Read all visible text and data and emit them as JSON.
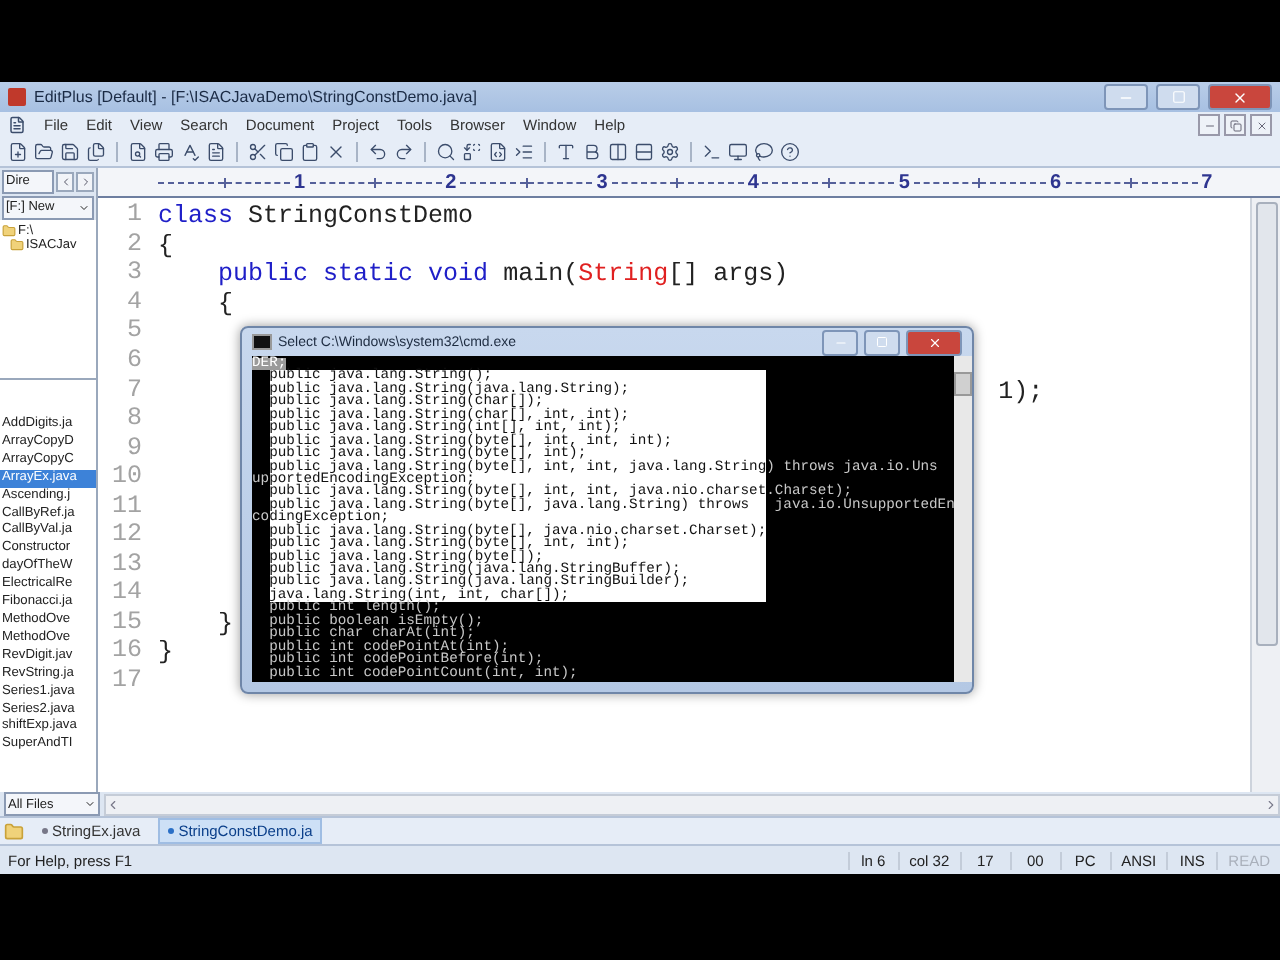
{
  "window": {
    "title": "EditPlus [Default] - [F:\\ISACJavaDemo\\StringConstDemo.java]"
  },
  "menu": [
    "File",
    "Edit",
    "View",
    "Search",
    "Document",
    "Project",
    "Tools",
    "Browser",
    "Window",
    "Help"
  ],
  "directory_panel": {
    "directory_label": "Dire",
    "drive": "[F:] New",
    "tree": [
      {
        "label": "F:\\",
        "children": [
          {
            "label": "ISACJav"
          }
        ]
      }
    ],
    "files": [
      {
        "name": "AddDigits.ja",
        "selected": false
      },
      {
        "name": "ArrayCopyD",
        "selected": false
      },
      {
        "name": "ArrayCopyC",
        "selected": false
      },
      {
        "name": "ArrayEx.java",
        "selected": true
      },
      {
        "name": "Ascending.j",
        "selected": false
      },
      {
        "name": "CallByRef.ja",
        "selected": false
      },
      {
        "name": "CallByVal.ja",
        "selected": false
      },
      {
        "name": "Constructor",
        "selected": false
      },
      {
        "name": "dayOfTheW",
        "selected": false
      },
      {
        "name": "ElectricalRe",
        "selected": false
      },
      {
        "name": "Fibonacci.ja",
        "selected": false
      },
      {
        "name": "MethodOve",
        "selected": false
      },
      {
        "name": "MethodOve",
        "selected": false
      },
      {
        "name": "RevDigit.jav",
        "selected": false
      },
      {
        "name": "RevString.ja",
        "selected": false
      },
      {
        "name": "Series1.java",
        "selected": false
      },
      {
        "name": "Series2.java",
        "selected": false
      },
      {
        "name": "shiftExp.java",
        "selected": false
      },
      {
        "name": "SuperAndTI",
        "selected": false
      }
    ],
    "filter": "All Files"
  },
  "ruler": [
    "1",
    "2",
    "3",
    "4",
    "5",
    "6",
    "7"
  ],
  "editor": {
    "lines": [
      {
        "number": "1",
        "tokens": [
          {
            "text": "class",
            "kind": "keyword"
          },
          {
            "text": " StringConstDemo",
            "kind": "plain"
          }
        ]
      },
      {
        "number": "2",
        "tokens": [
          {
            "text": "{",
            "kind": "plain"
          }
        ]
      },
      {
        "number": "3",
        "tokens": [
          {
            "text": "    public",
            "kind": "keyword"
          },
          {
            "text": " static",
            "kind": "keyword"
          },
          {
            "text": " void",
            "kind": "keyword"
          },
          {
            "text": " main(",
            "kind": "plain"
          },
          {
            "text": "String",
            "kind": "type"
          },
          {
            "text": "[] args)",
            "kind": "plain"
          }
        ]
      },
      {
        "number": "4",
        "tokens": [
          {
            "text": "    {",
            "kind": "plain"
          }
        ]
      },
      {
        "number": "5"
      },
      {
        "number": "6"
      },
      {
        "number": "7",
        "tokens": [
          {
            "text": "                                                        1);",
            "kind": "plain"
          }
        ]
      },
      {
        "number": "8"
      },
      {
        "number": "9"
      },
      {
        "number": "10"
      },
      {
        "number": "11"
      },
      {
        "number": "12"
      },
      {
        "number": "13"
      },
      {
        "number": "14"
      },
      {
        "number": "15",
        "tokens": [
          {
            "text": "    }",
            "kind": "plain"
          }
        ]
      },
      {
        "number": "16",
        "tokens": [
          {
            "text": "}",
            "kind": "plain"
          }
        ]
      },
      {
        "number": "17"
      }
    ]
  },
  "console": {
    "title": "Select C:\\Windows\\system32\\cmd.exe",
    "rows": [
      {
        "kind": "mark",
        "text": "DER;"
      },
      {
        "kind": "block",
        "before": "  ",
        "selection": "public java.lang.String();"
      },
      {
        "kind": "block",
        "before": "  ",
        "selection": "public java.lang.String(java.lang.String);"
      },
      {
        "kind": "block",
        "before": "  ",
        "selection": "public java.lang.String(char[]);"
      },
      {
        "kind": "block",
        "before": "  ",
        "selection": "public java.lang.String(char[], int, int);"
      },
      {
        "kind": "block",
        "before": "  ",
        "selection": "public java.lang.String(int[], int, int);"
      },
      {
        "kind": "block",
        "before": "  ",
        "selection": "public java.lang.String(byte[], int, int, int);"
      },
      {
        "kind": "block",
        "before": "  ",
        "selection": "public java.lang.String(byte[], int);"
      },
      {
        "kind": "block",
        "before": "  ",
        "selection": "public java.lang.String(byte[], int, int, java.lang.String",
        "after": ") throws java.io.Uns"
      },
      {
        "kind": "block",
        "before": "up",
        "selection": "portedEncodingException;"
      },
      {
        "kind": "block",
        "before": "  ",
        "selection": "public java.lang.String(byte[], int, int, java.nio.charset",
        "after": ".Charset);"
      },
      {
        "kind": "block",
        "before": "  ",
        "selection": "public java.lang.String(byte[], java.lang.String) throws",
        "after": " java.io.UnsupportedEn"
      },
      {
        "kind": "block",
        "before": "co",
        "selection": "dingException;"
      },
      {
        "kind": "block",
        "before": "  ",
        "selection": "public java.lang.String(byte[], java.nio.charset.Charset);"
      },
      {
        "kind": "block",
        "before": "  ",
        "selection": "public java.lang.String(byte[], int, int);"
      },
      {
        "kind": "block",
        "before": "  ",
        "selection": "public java.lang.String(byte[]);"
      },
      {
        "kind": "block",
        "before": "  ",
        "selection": "public java.lang.String(java.lang.StringBuffer);"
      },
      {
        "kind": "block",
        "before": "  ",
        "selection": "public java.lang.String(java.lang.StringBuilder);"
      },
      {
        "kind": "block",
        "before": "  ",
        "selection": "java.lang.String(int, int, char[]);"
      },
      {
        "kind": "plain",
        "text": "  public int length();"
      },
      {
        "kind": "plain",
        "text": "  public boolean isEmpty();"
      },
      {
        "kind": "plain",
        "text": "  public char charAt(int);"
      },
      {
        "kind": "plain",
        "text": "  public int codePointAt(int);"
      },
      {
        "kind": "plain",
        "text": "  public int codePointBefore(int);"
      },
      {
        "kind": "plain",
        "text": "  public int codePointCount(int, int);"
      }
    ]
  },
  "document_tabs": [
    {
      "label": "StringEx.java",
      "selected": false
    },
    {
      "label": "StringConstDemo.ja",
      "selected": true
    }
  ],
  "status_bar": {
    "message": "For Help, press F1",
    "fields": [
      {
        "text": "ln 6",
        "disabled": false
      },
      {
        "text": "col 32",
        "disabled": false
      },
      {
        "text": "17",
        "disabled": false
      },
      {
        "text": "00",
        "disabled": false
      },
      {
        "text": "PC",
        "disabled": false
      },
      {
        "text": "ANSI",
        "disabled": false
      },
      {
        "text": "INS",
        "disabled": false
      },
      {
        "text": "READ",
        "disabled": true
      }
    ]
  }
}
